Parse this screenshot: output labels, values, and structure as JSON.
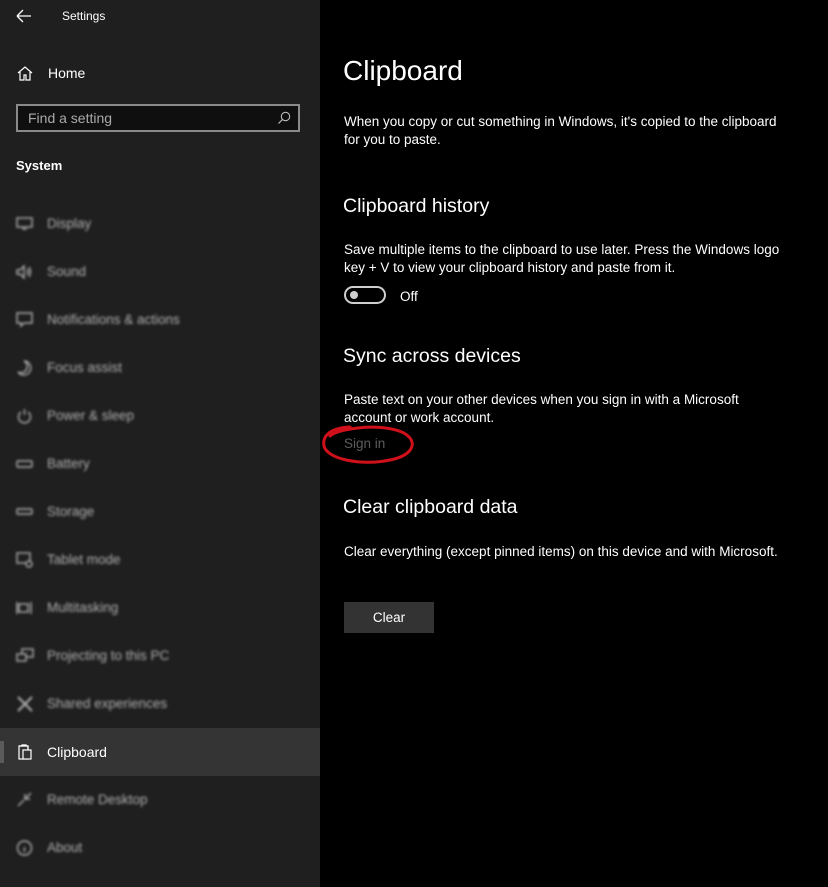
{
  "window": {
    "title": "Settings"
  },
  "sidebar": {
    "home_label": "Home",
    "search": {
      "placeholder": "Find a setting",
      "value": ""
    },
    "section_label": "System",
    "items": [
      {
        "label": "Display",
        "icon": "display-icon",
        "active": false
      },
      {
        "label": "Sound",
        "icon": "sound-icon",
        "active": false
      },
      {
        "label": "Notifications & actions",
        "icon": "notifications-icon",
        "active": false
      },
      {
        "label": "Focus assist",
        "icon": "moon-icon",
        "active": false
      },
      {
        "label": "Power & sleep",
        "icon": "power-icon",
        "active": false
      },
      {
        "label": "Battery",
        "icon": "battery-icon",
        "active": false
      },
      {
        "label": "Storage",
        "icon": "storage-icon",
        "active": false
      },
      {
        "label": "Tablet mode",
        "icon": "tablet-mode-icon",
        "active": false
      },
      {
        "label": "Multitasking",
        "icon": "multitasking-icon",
        "active": false
      },
      {
        "label": "Projecting to this PC",
        "icon": "projecting-icon",
        "active": false
      },
      {
        "label": "Shared experiences",
        "icon": "shared-experiences-icon",
        "active": false
      },
      {
        "label": "Clipboard",
        "icon": "clipboard-icon",
        "active": true
      },
      {
        "label": "Remote Desktop",
        "icon": "remote-desktop-icon",
        "active": false
      },
      {
        "label": "About",
        "icon": "info-icon",
        "active": false
      }
    ]
  },
  "main": {
    "title": "Clipboard",
    "intro": "When you copy or cut something in Windows, it's copied to the clipboard for you to paste.",
    "history": {
      "heading": "Clipboard history",
      "description": "Save multiple items to the clipboard to use later. Press the Windows logo key + V to view your clipboard history and paste from it.",
      "toggle_state": "Off"
    },
    "sync": {
      "heading": "Sync across devices",
      "description": "Paste text on your other devices when you sign in with a Microsoft account or work account.",
      "signin_label": "Sign in"
    },
    "clear": {
      "heading": "Clear clipboard data",
      "description": "Clear everything (except pinned items) on this device and with Microsoft.",
      "button_label": "Clear"
    }
  },
  "colors": {
    "sidebar_bg": "#1f1f1f",
    "main_bg": "#000000",
    "active_item_bg": "#343434",
    "annotation_red": "#d0101a",
    "disabled_link": "#5c5c5c"
  }
}
